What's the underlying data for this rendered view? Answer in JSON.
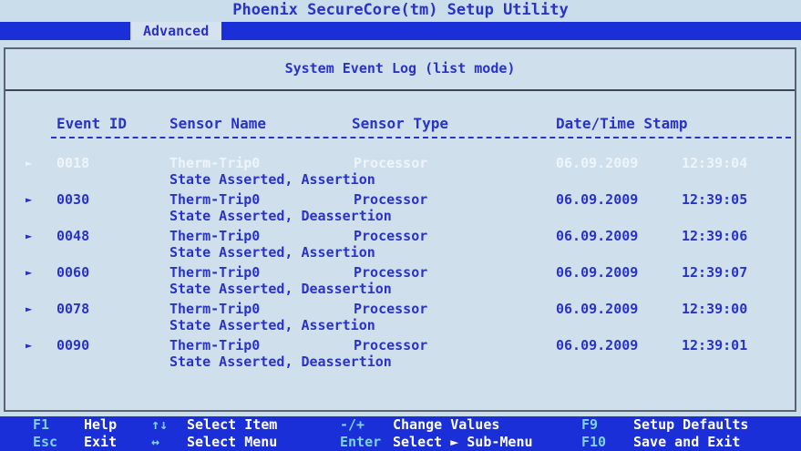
{
  "title": "Phoenix SecureCore(tm) Setup Utility",
  "menu": {
    "active_tab": "Advanced"
  },
  "panel": {
    "title": "System Event Log (list mode)"
  },
  "columns": {
    "event_id": "Event ID",
    "sensor_name": "Sensor Name",
    "sensor_type": "Sensor Type",
    "datetime": "Date/Time Stamp"
  },
  "events": [
    {
      "marker": "►",
      "id": "0018",
      "sensor": "Therm-Trip0",
      "type": "Processor",
      "date": "06.09.2009",
      "time": "12:39:04",
      "detail": "State Asserted, Assertion"
    },
    {
      "marker": "►",
      "id": "0030",
      "sensor": "Therm-Trip0",
      "type": "Processor",
      "date": "06.09.2009",
      "time": "12:39:05",
      "detail": "State Asserted, Deassertion"
    },
    {
      "marker": "►",
      "id": "0048",
      "sensor": "Therm-Trip0",
      "type": "Processor",
      "date": "06.09.2009",
      "time": "12:39:06",
      "detail": "State Asserted, Assertion"
    },
    {
      "marker": "►",
      "id": "0060",
      "sensor": "Therm-Trip0",
      "type": "Processor",
      "date": "06.09.2009",
      "time": "12:39:07",
      "detail": "State Asserted, Deassertion"
    },
    {
      "marker": "►",
      "id": "0078",
      "sensor": "Therm-Trip0",
      "type": "Processor",
      "date": "06.09.2009",
      "time": "12:39:00",
      "detail": "State Asserted, Assertion"
    },
    {
      "marker": "►",
      "id": "0090",
      "sensor": "Therm-Trip0",
      "type": "Processor",
      "date": "06.09.2009",
      "time": "12:39:01",
      "detail": "State Asserted, Deassertion"
    }
  ],
  "selected_index": 0,
  "footer": {
    "row1": [
      {
        "key": "F1",
        "label": "Help"
      },
      {
        "key": "↑↓",
        "label": "Select Item"
      },
      {
        "key": "-/+",
        "label": "Change Values"
      },
      {
        "key": "F9",
        "label": "Setup Defaults"
      }
    ],
    "row2": [
      {
        "key": "Esc",
        "label": "Exit"
      },
      {
        "key": "↔",
        "label": "Select Menu"
      },
      {
        "key": "Enter",
        "label": "Select ► Sub-Menu"
      },
      {
        "key": "F10",
        "label": "Save and Exit"
      }
    ]
  },
  "colors": {
    "text": "#2a33c8",
    "bar": "#1a2fd8",
    "background": "#c9ddea",
    "footer_key": "#7fd3e6"
  }
}
